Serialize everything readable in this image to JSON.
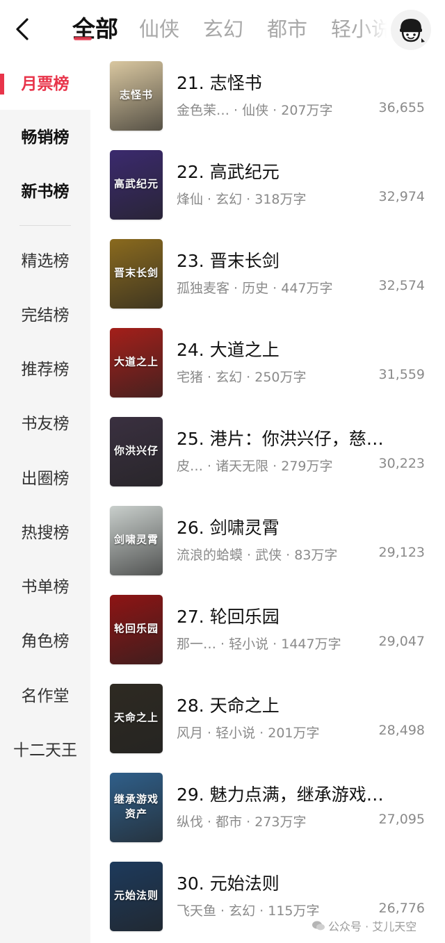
{
  "header": {
    "tabs": [
      {
        "label": "全部"
      },
      {
        "label": "仙侠"
      },
      {
        "label": "玄幻"
      },
      {
        "label": "都市"
      },
      {
        "label": "轻小说"
      }
    ]
  },
  "sidebar": {
    "items": [
      {
        "label": "月票榜"
      },
      {
        "label": "畅销榜"
      },
      {
        "label": "新书榜"
      },
      {
        "label": "精选榜"
      },
      {
        "label": "完结榜"
      },
      {
        "label": "推荐榜"
      },
      {
        "label": "书友榜"
      },
      {
        "label": "出圈榜"
      },
      {
        "label": "热搜榜"
      },
      {
        "label": "书单榜"
      },
      {
        "label": "角色榜"
      },
      {
        "label": "名作堂"
      },
      {
        "label": "十二天王"
      }
    ]
  },
  "books": [
    {
      "title": "21. 志怪书",
      "meta": "金色茉…  · 仙侠 · 207万字",
      "count": "36,655",
      "cover_text": "志怪书",
      "cover_color": "#d9c7a0"
    },
    {
      "title": "22. 高武纪元",
      "meta": "烽仙 · 玄幻 · 318万字",
      "count": "32,974",
      "cover_text": "高武纪元",
      "cover_color": "#3b2a6e"
    },
    {
      "title": "23. 晋末长剑",
      "meta": "孤独麦客 · 历史 · 447万字",
      "count": "32,574",
      "cover_text": "晋末长剑",
      "cover_color": "#8a6a1e"
    },
    {
      "title": "24. 大道之上",
      "meta": "宅猪 · 玄幻 · 250万字",
      "count": "31,559",
      "cover_text": "大道之上",
      "cover_color": "#a41f1a"
    },
    {
      "title": "25. 港片：你洪兴仔，慈…",
      "meta": "皮…     · 诸天无限 · 279万字",
      "count": "30,223",
      "cover_text": "你洪兴仔",
      "cover_color": "#3a3040"
    },
    {
      "title": "26. 剑啸灵霄",
      "meta": "流浪的蛤蟆 · 武侠 · 83万字",
      "count": "29,123",
      "cover_text": "剑啸灵霄",
      "cover_color": "#c9cfcc"
    },
    {
      "title": "27. 轮回乐园",
      "meta": "那一… · 轻小说 · 1447万字",
      "count": "29,047",
      "cover_text": "轮回乐园",
      "cover_color": "#8e1414"
    },
    {
      "title": "28. 天命之上",
      "meta": "风月 · 轻小说 · 201万字",
      "count": "28,498",
      "cover_text": "天命之上",
      "cover_color": "#2e2a22"
    },
    {
      "title": "29. 魅力点满，继承游戏…",
      "meta": "纵伐 · 都市 · 273万字",
      "count": "27,095",
      "cover_text": "继承游戏资产",
      "cover_color": "#2f5f8a"
    },
    {
      "title": "30. 元始法则",
      "meta": "飞天鱼 · 玄幻 · 115万字",
      "count": "26,776",
      "cover_text": "元始法则",
      "cover_color": "#1d3a5c"
    }
  ],
  "watermark": {
    "text": "公众号 · 艾儿天空"
  },
  "colors": {
    "accent": "#e8344a",
    "sidebar_bg": "#f5f5f5"
  }
}
